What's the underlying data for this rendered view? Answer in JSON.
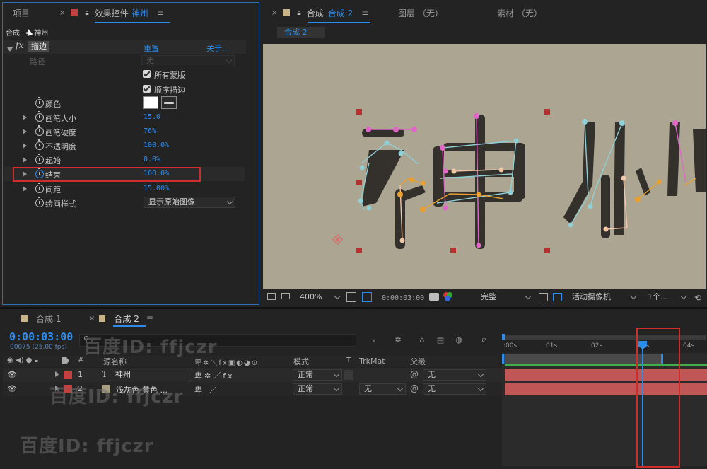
{
  "top_left_tabs": {
    "project_label": "项目",
    "effects_prefix": "效果控件",
    "effects_layer": "神州",
    "menu": "≡"
  },
  "top_right_tabs": {
    "comp_prefix": "合成",
    "comp_name": "合成 2",
    "layer_label": "图层 （无）",
    "footage_label": "素材 （无）",
    "menu": "≡"
  },
  "effects_panel": {
    "breadcrumb_comp": "合成",
    "breadcrumb_layer": "神州",
    "effect_name": "描边",
    "reset_label": "重置",
    "about_label": "关于...",
    "path_label": "路径",
    "path_value": "无",
    "all_masks_label": "所有蒙版",
    "sequential_label": "顺序描边",
    "properties": [
      {
        "label": "颜色",
        "value": ""
      },
      {
        "label": "画笔大小",
        "value": "15.0"
      },
      {
        "label": "画笔硬度",
        "value": "76%"
      },
      {
        "label": "不透明度",
        "value": "100.0%"
      },
      {
        "label": "起始",
        "value": "0.0%"
      },
      {
        "label": "结束",
        "value": "100.0%"
      },
      {
        "label": "间距",
        "value": "15.00%"
      },
      {
        "label": "绘画样式",
        "value": "显示原始图像"
      }
    ],
    "colors": {
      "stroke_color": "#ffffff"
    }
  },
  "viewer": {
    "comp_tab": "合成 2",
    "canvas_text": "神州",
    "zoom": "400%",
    "timecode": "0:00:03:00",
    "resolution": "完整",
    "camera": "活动摄像机",
    "views": "1个..."
  },
  "timeline": {
    "tabs": [
      "合成 1",
      "合成 2"
    ],
    "menu": "≡",
    "current_time": "0:00:03:00",
    "fps_label": "00075 (25.00 fps)",
    "search_placeholder": "",
    "columns": {
      "num": "#",
      "source_name": "源名称",
      "mode": "模式",
      "t": "T",
      "trkmat": "TrkMat",
      "parent": "父级"
    },
    "ruler_ticks": [
      ":00s",
      "01s",
      "02s",
      "03s",
      "04s"
    ],
    "layers": [
      {
        "num": "1",
        "type": "T",
        "name": "神州",
        "mode": "正常",
        "trkmat": "",
        "parent": "无"
      },
      {
        "num": "2",
        "type": "solid",
        "name": "浅灰色-黄色 ...",
        "mode": "正常",
        "trkmat": "无",
        "parent": "无"
      }
    ],
    "colors": {
      "layer_bar": "#c05656",
      "time_blue": "#2d8ceb"
    }
  },
  "watermarks": [
    "百度ID: ffjczr",
    "百度ID: ffjczr",
    "百度ID: ffjczr"
  ]
}
